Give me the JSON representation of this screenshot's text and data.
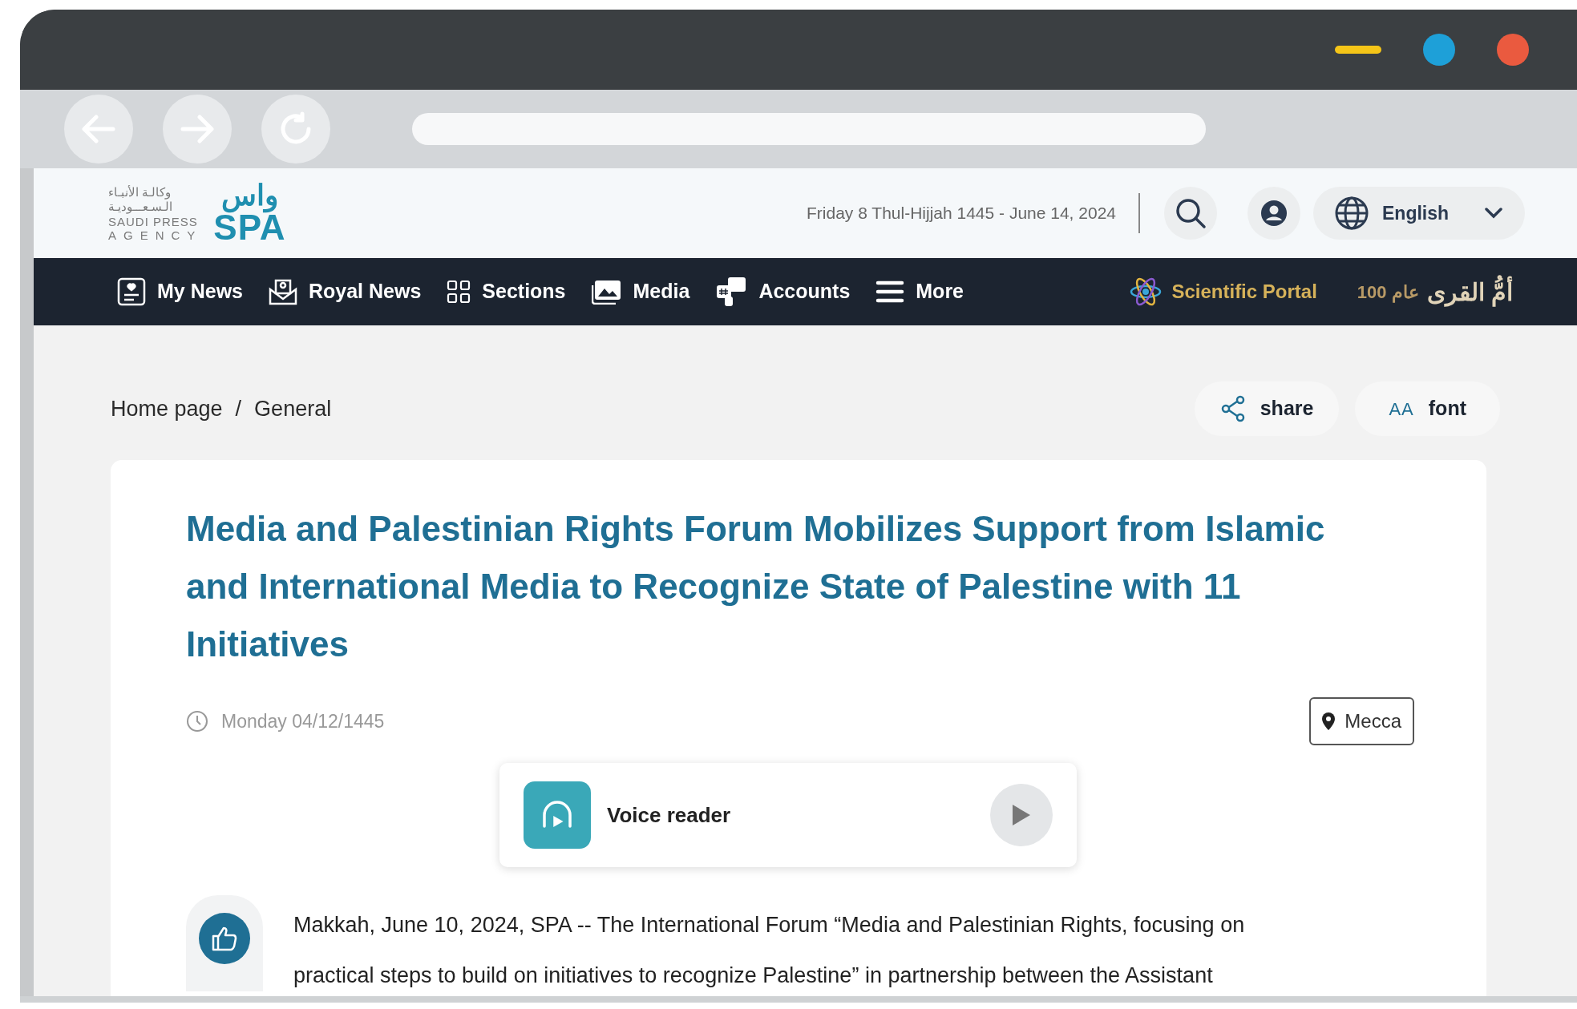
{
  "logo": {
    "arabic_line_1": "وكالـة الأنبـاء",
    "arabic_line_2": "الـسـعـــوديـة",
    "english_line_1": "SAUDI PRESS",
    "english_line_2": "AGENCY",
    "mark_top": "واس",
    "mark_bottom": "SPA"
  },
  "header": {
    "date": "Friday 8 Thul-Hijjah 1445 - June 14, 2024",
    "language": "English"
  },
  "nav": {
    "items": [
      {
        "label": "My News",
        "kind": "mynews"
      },
      {
        "label": "Royal News",
        "kind": "royal"
      },
      {
        "label": "Sections",
        "kind": "sections"
      },
      {
        "label": "Media",
        "kind": "media"
      },
      {
        "label": "Accounts",
        "kind": "accounts"
      },
      {
        "label": "More",
        "kind": "more"
      }
    ],
    "portal": "Scientific Portal",
    "partner_name": "أمُّ القرى",
    "partner_years": "100 عام"
  },
  "breadcrumb": {
    "items": [
      "Home page",
      "General"
    ],
    "separator": "/"
  },
  "actions": [
    {
      "kind": "share",
      "label": "share"
    },
    {
      "kind": "font",
      "label": "font",
      "glyph": "AA"
    }
  ],
  "article": {
    "title": "Media and Palestinian Rights Forum Mobilizes Support from Islamic and International Media to Recognize State of Palestine with 11 Initiatives",
    "date": "Monday 04/12/1445",
    "location": "Mecca",
    "voice_reader": "Voice reader",
    "body": "Makkah, June 10, 2024, SPA -- The International Forum “Media and Palestinian Rights, focusing on practical steps to build on initiatives to recognize Palestine” in partnership between the Assistant"
  }
}
